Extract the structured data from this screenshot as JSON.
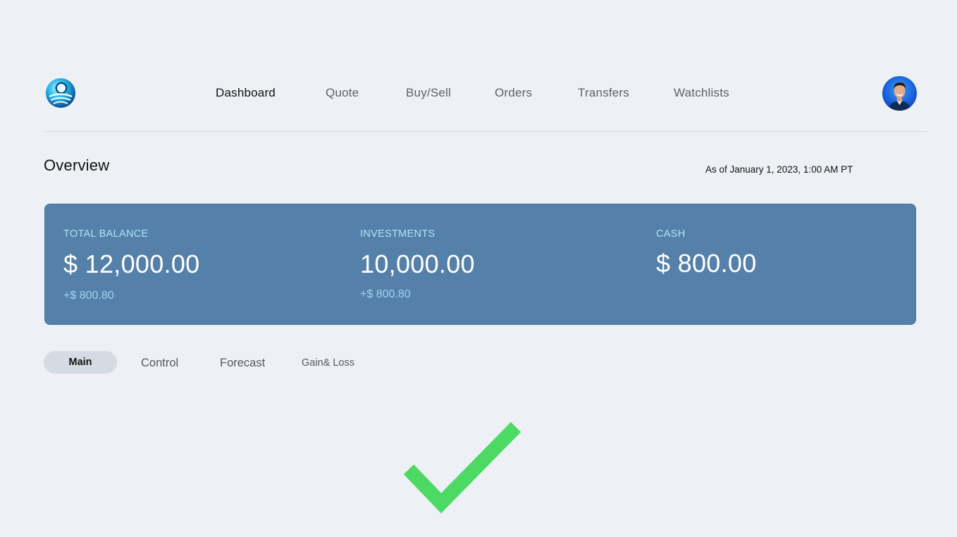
{
  "header": {
    "nav": [
      {
        "label": "Dashboard",
        "active": true
      },
      {
        "label": "Quote",
        "active": false
      },
      {
        "label": "Buy/Sell",
        "active": false
      },
      {
        "label": "Orders",
        "active": false
      },
      {
        "label": "Transfers",
        "active": false
      },
      {
        "label": "Watchlists",
        "active": false
      }
    ]
  },
  "overview": {
    "title": "Overview",
    "as_of": "As of January 1, 2023, 1:00 AM PT"
  },
  "card": {
    "stats": [
      {
        "label": "TOTAL BALANCE",
        "value": "$ 12,000.00",
        "change": "+$ 800.80"
      },
      {
        "label": "INVESTMENTS",
        "value": "10,000.00",
        "change": "+$ 800.80"
      },
      {
        "label": "CASH",
        "value": "$ 800.00",
        "change": ""
      }
    ]
  },
  "tabs": [
    {
      "label": "Main",
      "active": true
    },
    {
      "label": "Control",
      "active": false
    },
    {
      "label": "Forecast",
      "active": false
    },
    {
      "label": "Gain& Loss",
      "active": false
    }
  ],
  "icons": {
    "logo": "globe-logo-icon",
    "avatar": "user-avatar",
    "success": "check-mark-icon"
  },
  "colors": {
    "background": "#edf0f5",
    "card": "#5580a9",
    "card_label": "#a9e6f6",
    "card_change": "#9fd3ef",
    "active_tab": "#d5dbe2",
    "check": "#4cd964"
  }
}
